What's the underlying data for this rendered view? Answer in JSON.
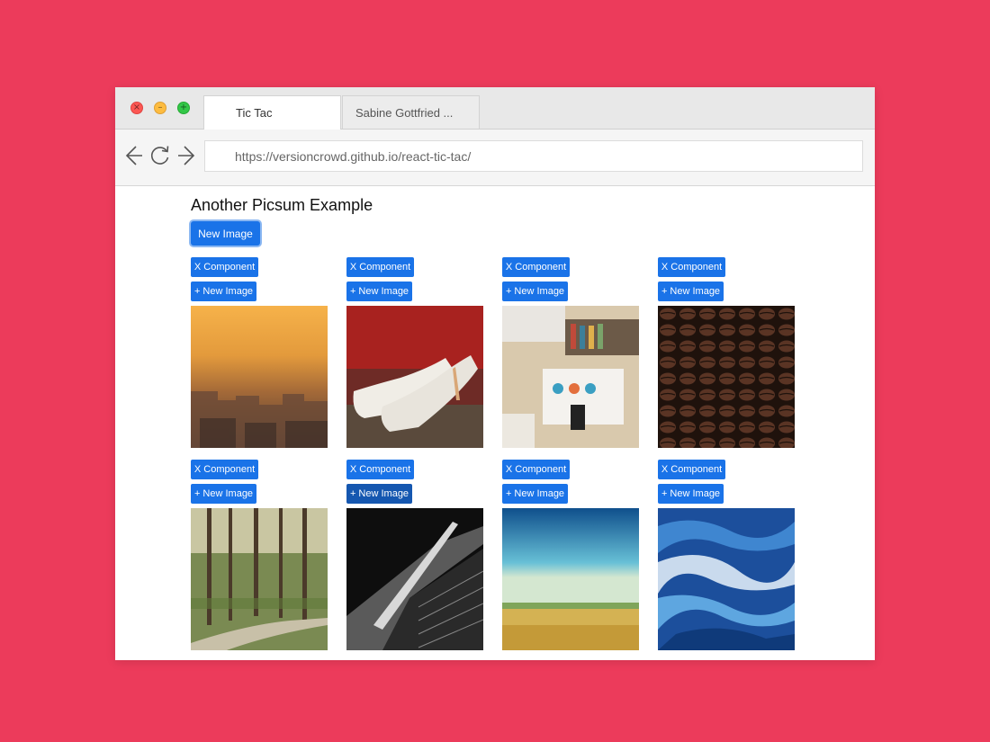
{
  "browser": {
    "tabs": [
      {
        "label": "Tic Tac"
      },
      {
        "label": "Sabine Gottfried ..."
      }
    ],
    "url": "https://versioncrowd.github.io/react-tic-tac/",
    "icons": {
      "close": "close-icon",
      "minimize": "minimize-icon",
      "maximize": "maximize-icon",
      "back": "back-arrow-icon",
      "reload": "reload-icon",
      "forward": "forward-arrow-icon"
    },
    "colors": {
      "background": "#ec3b5b",
      "button": "#1a73e8"
    }
  },
  "page": {
    "title": "Another Picsum Example",
    "new_image_label": "New Image",
    "cards": [
      {
        "x_label": "X Component",
        "new_label": "+ New Image",
        "image": "city skyline at sunset"
      },
      {
        "x_label": "X Component",
        "new_label": "+ New Image",
        "image": "white high heel shoes"
      },
      {
        "x_label": "X Component",
        "new_label": "+ New Image",
        "image": "desk with keyboard and phone"
      },
      {
        "x_label": "X Component",
        "new_label": "+ New Image",
        "image": "coffee beans"
      },
      {
        "x_label": "X Component",
        "new_label": "+ New Image",
        "image": "forest path"
      },
      {
        "x_label": "X Component",
        "new_label": "+ New Image",
        "image": "black and white building"
      },
      {
        "x_label": "X Component",
        "new_label": "+ New Image",
        "image": "wheat field under blue sky"
      },
      {
        "x_label": "X Component",
        "new_label": "+ New Image",
        "image": "ocean waves"
      }
    ]
  }
}
